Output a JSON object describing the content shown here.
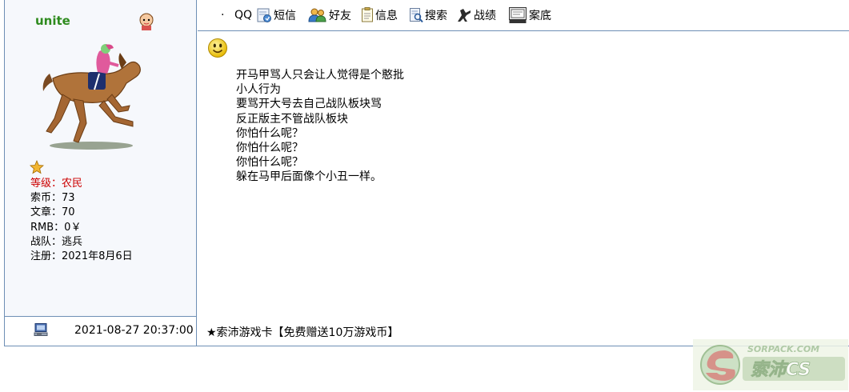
{
  "user": {
    "name": "unite",
    "level_label": "等级：",
    "level_value": "农民",
    "coins": "索币：73",
    "articles": "文章：70",
    "rmb": "RMB：0￥",
    "team": "战队：逃兵",
    "registered": "注册：2021年8月6日"
  },
  "toolbar": {
    "qq": "QQ",
    "sms": "短信",
    "friends": "好友",
    "info": "信息",
    "search": "搜索",
    "stats": "战绩",
    "archive": "案底"
  },
  "message": {
    "lines": [
      "开马甲骂人只会让人觉得是个憨批",
      "小人行为",
      "要骂开大号去自己战队板块骂",
      "反正版主不管战队板块",
      "你怕什么呢？",
      "你怕什么呢？",
      "你怕什么呢？",
      "躲在马甲后面像个小丑一样。"
    ]
  },
  "footer": {
    "timestamp": "2021-08-27 20:37:00",
    "ad_text": "★索沛游戏卡【免费赠送10万游戏币】"
  },
  "watermark": {
    "url_text": "SORPACK.COM",
    "brand_text": "索沛CS"
  },
  "colors": {
    "border": "#6e8fb5",
    "username": "#2e8b1e",
    "level": "#cc0000",
    "panel_bg": "#f6f8fc"
  },
  "icons": [
    "gender-icon",
    "horse-avatar",
    "rank-star-icon",
    "sms-icon",
    "friends-icon",
    "info-icon",
    "search-icon",
    "stats-icon",
    "archive-icon",
    "smiley-icon",
    "computer-icon"
  ]
}
